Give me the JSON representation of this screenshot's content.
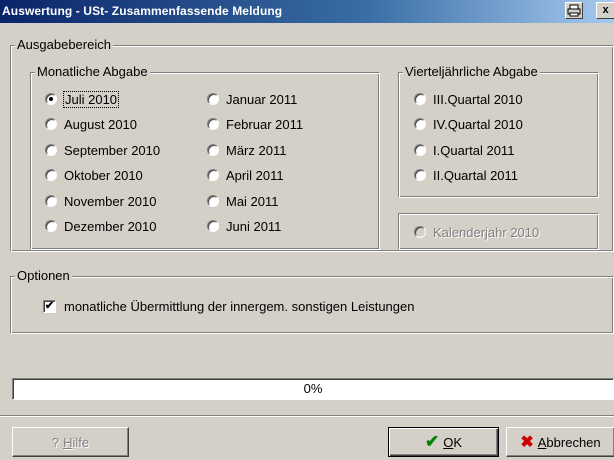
{
  "window": {
    "title": "Auswertung - USt- Zusammenfassende Meldung",
    "print_icon": "printer-icon",
    "close_glyph": "x"
  },
  "ausgabebereich": {
    "label": "Ausgabebereich",
    "monatlich": {
      "label": "Monatliche Abgabe",
      "col1": [
        "Juli 2010",
        "August 2010",
        "September 2010",
        "Oktober 2010",
        "November 2010",
        "Dezember 2010"
      ],
      "col2": [
        "Januar 2011",
        "Februar 2011",
        "März 2011",
        "April 2011",
        "Mai 2011",
        "Juni 2011"
      ],
      "selected": "Juli 2010"
    },
    "vierteljaehrlich": {
      "label": "Vierteljährliche Abgabe",
      "items": [
        "III.Quartal 2010",
        "IV.Quartal 2010",
        "I.Quartal 2011",
        "II.Quartal 2011"
      ]
    },
    "kalenderjahr": {
      "label": "Kalenderjahr 2010",
      "enabled": false
    }
  },
  "optionen": {
    "label": "Optionen",
    "checkbox_label": "monatliche Übermittlung der innergem. sonstigen Leistungen",
    "checked": true
  },
  "progress": {
    "text": "0%",
    "value": 0
  },
  "buttons": {
    "hilfe": {
      "prefix": "",
      "mnemonic": "H",
      "rest": "ilfe",
      "enabled": false,
      "icon": "help-icon"
    },
    "ok": {
      "mnemonic": "O",
      "rest": "K",
      "icon": "checkmark-icon",
      "icon_color": "#008000"
    },
    "abbrechen": {
      "mnemonic": "A",
      "rest": "bbrechen",
      "icon": "cross-icon",
      "icon_color": "#cc0000"
    }
  }
}
